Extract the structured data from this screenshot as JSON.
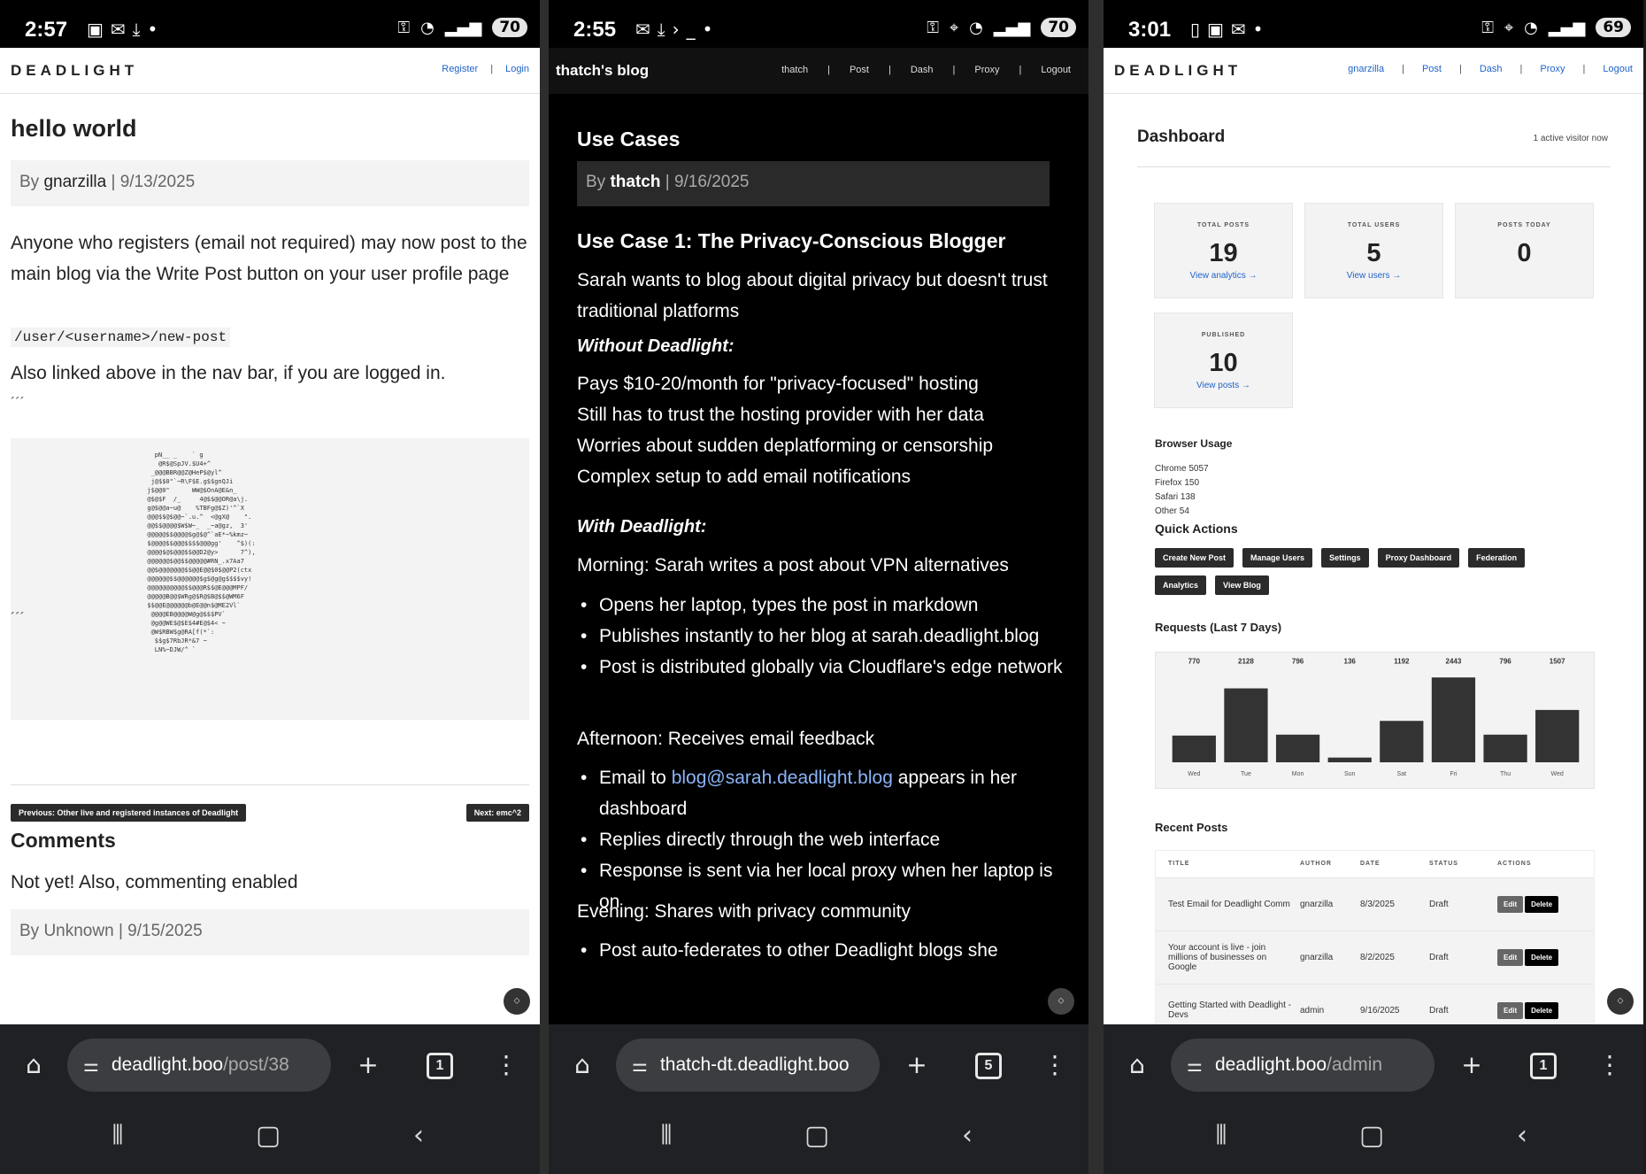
{
  "panel1": {
    "status": {
      "time": "2:57",
      "battery": "70"
    },
    "header": {
      "brand": "DEADLIGHT",
      "links": [
        "Register",
        "Login"
      ]
    },
    "post": {
      "title": "hello world",
      "meta_prefix": "By ",
      "author": "gnarzilla",
      "date_suffix": " | 9/13/2025",
      "para1": "Anyone who registers (email not required) may now post to the main blog via the Write Post button on your user profile page",
      "code": "/user/<username>/new-post",
      "para2": "Also linked above in the nav bar, if you are logged in.",
      "ticks": "´´´"
    },
    "pager": {
      "prev": "Previous: Other live and registered instances of Deadlight",
      "next": "Next: emc^2"
    },
    "comments": {
      "heading": "Comments",
      "text": "Not yet! Also, commenting enabled",
      "meta": "By Unknown | 9/15/2025"
    },
    "url": {
      "host": "deadlight.boo",
      "path": "/post/38"
    },
    "tabs": "1"
  },
  "panel2": {
    "status": {
      "time": "2:55",
      "battery": "70"
    },
    "header": {
      "brand": "thatch's blog",
      "links": [
        "thatch",
        "Post",
        "Dash",
        "Proxy",
        "Logout"
      ]
    },
    "post": {
      "title": "Use Cases",
      "meta_prefix": "By ",
      "author": "thatch",
      "date_suffix": " | 9/16/2025",
      "h3": "Use Case 1: The Privacy-Conscious Blogger",
      "intro": "Sarah wants to blog about digital privacy but doesn't trust traditional platforms",
      "without": "Without Deadlight:",
      "without_items": [
        "Pays $10-20/month for \"privacy-focused\" hosting",
        "Still has to trust the hosting provider with her data",
        "Worries about sudden deplatforming or censorship",
        "Complex setup to add email notifications"
      ],
      "with": "With Deadlight:",
      "morning": "Morning: Sarah writes a post about VPN alternatives",
      "morning_items": [
        "Opens her laptop, types the post in markdown",
        "Publishes instantly to her blog at sarah.deadlight.blog",
        "Post is distributed globally via Cloudflare's edge network"
      ],
      "afternoon": "Afternoon: Receives email feedback",
      "email_prefix": "Email to ",
      "email": "blog@sarah.deadlight.blog",
      "email_suffix": " appears in her dashboard",
      "afternoon_items": [
        "Replies directly through the web interface",
        "Response is sent via her local proxy when her laptop is on"
      ],
      "evening": "Evening: Shares with privacy community",
      "evening_items": [
        "Post auto-federates to other Deadlight blogs she"
      ]
    },
    "url": {
      "host": "thatch-dt.deadlight.boo",
      "path": ""
    },
    "tabs": "5"
  },
  "panel3": {
    "status": {
      "time": "3:01",
      "battery": "69"
    },
    "header": {
      "brand": "DEADLIGHT",
      "links": [
        "gnarzilla",
        "Post",
        "Dash",
        "Proxy",
        "Logout"
      ]
    },
    "dashboard": {
      "title": "Dashboard",
      "visitors": "1 active visitor now"
    },
    "stats": [
      {
        "label": "TOTAL POSTS",
        "value": "19",
        "link": "View analytics →"
      },
      {
        "label": "TOTAL USERS",
        "value": "5",
        "link": "View users →"
      },
      {
        "label": "POSTS TODAY",
        "value": "0",
        "link": ""
      },
      {
        "label": "PUBLISHED",
        "value": "10",
        "link": "View posts →"
      }
    ],
    "browser_usage": {
      "title": "Browser Usage",
      "items": [
        "Chrome 5057",
        "Firefox 150",
        "Safari 138",
        "Other 54"
      ]
    },
    "quick_actions": {
      "title": "Quick Actions",
      "buttons": [
        "Create New Post",
        "Manage Users",
        "Settings",
        "Proxy Dashboard",
        "Federation",
        "Analytics",
        "View Blog"
      ]
    },
    "requests_title": "Requests (Last 7 Days)",
    "recent": {
      "title": "Recent Posts",
      "headers": [
        "TITLE",
        "AUTHOR",
        "DATE",
        "STATUS",
        "ACTIONS"
      ],
      "rows": [
        {
          "title": "Test Email for Deadlight Comm",
          "author": "gnarzilla",
          "date": "8/3/2025",
          "status": "Draft"
        },
        {
          "title": "Your account is live - join millions of businesses on Google",
          "author": "gnarzilla",
          "date": "8/2/2025",
          "status": "Draft"
        },
        {
          "title": "Getting Started with Deadlight - Devs",
          "author": "admin",
          "date": "9/16/2025",
          "status": "Draft"
        }
      ],
      "edit": "Edit",
      "delete": "Delete"
    },
    "url": {
      "host": "deadlight.boo",
      "path": "/admin"
    },
    "tabs": "1"
  },
  "chart_data": {
    "type": "bar",
    "categories": [
      "Wed",
      "Tue",
      "Mon",
      "Sun",
      "Sat",
      "Fri",
      "Thu",
      "Wed"
    ],
    "values": [
      770,
      2128,
      796,
      136,
      1192,
      2443,
      796,
      1507
    ],
    "title": "Requests (Last 7 Days)",
    "xlabel": "",
    "ylabel": "",
    "ylim": [
      0,
      2600
    ],
    "bar_color": "#333333"
  },
  "colors": {
    "link": "#1f63c9",
    "dark_bg": "#000000",
    "pill": "#2b2b2b"
  }
}
